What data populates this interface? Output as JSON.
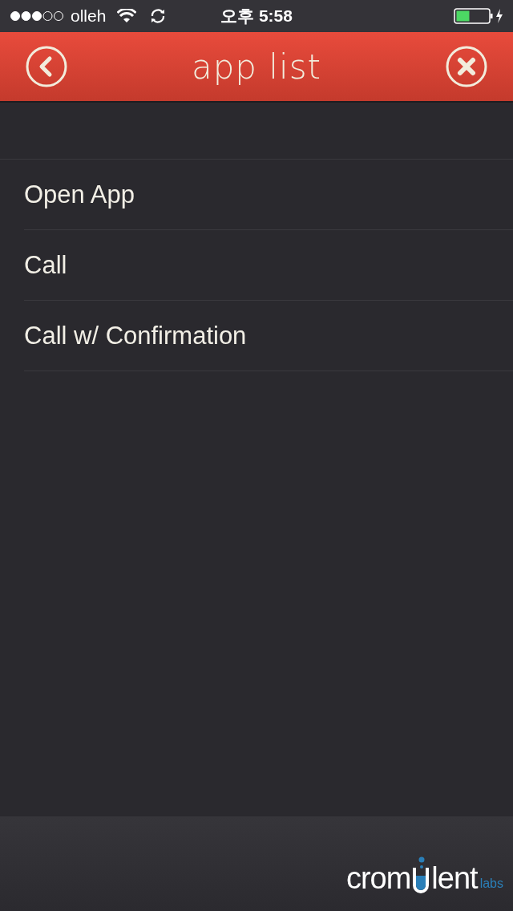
{
  "status_bar": {
    "carrier": "olleh",
    "time": "오후 5:58"
  },
  "header": {
    "title": "app list"
  },
  "items": [
    {
      "label": "Open App"
    },
    {
      "label": "Call"
    },
    {
      "label": "Call w/ Confirmation"
    }
  ],
  "footer": {
    "logo_start": "crom",
    "logo_end": "lent",
    "logo_suffix": "labs"
  }
}
